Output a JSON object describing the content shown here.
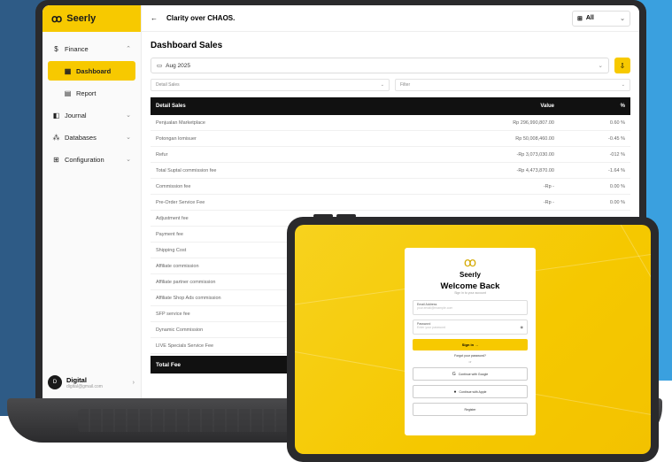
{
  "app": {
    "brand": "Seerly",
    "header_title": "Clarity over CHAOS.",
    "filter_all": "All"
  },
  "sidebar": {
    "items": [
      {
        "label": "Finance",
        "icon": "dollar-icon"
      },
      {
        "label": "Dashboard",
        "icon": "grid-icon"
      },
      {
        "label": "Report",
        "icon": "document-icon"
      },
      {
        "label": "Journal",
        "icon": "book-icon"
      },
      {
        "label": "Databases",
        "icon": "database-icon"
      },
      {
        "label": "Configuration",
        "icon": "settings-icon"
      }
    ],
    "user": {
      "initial": "D",
      "name": "Digital",
      "email": "digital@gmail.com"
    }
  },
  "dashboard": {
    "title": "Dashboard Sales",
    "date_value": "Aug 2025",
    "filter_detail": "Detail Sales",
    "filter_filter": "Filter",
    "table_header": {
      "name": "Detail Sales",
      "value": "Value",
      "pct": "%"
    },
    "rows": [
      {
        "name": "Penjualan Marketplace",
        "value": "Rp 296,990,807.00",
        "pct": "0.60 %"
      },
      {
        "name": "Potongan lomisuer",
        "value": "Rp 50,008,460.00",
        "pct": "-0.45 %"
      },
      {
        "name": "Refur",
        "value": "-Rp 3,073,030.00",
        "pct": "-012 %"
      },
      {
        "name": "Total Suptal commission fee",
        "value": "-Rp 4,473,870.00",
        "pct": "-1.64 %"
      },
      {
        "name": "Commission fee",
        "value": "-Rp -",
        "pct": "0.00 %"
      },
      {
        "name": "Pre-Order Service Fee",
        "value": "-Rp -",
        "pct": "0.00 %"
      },
      {
        "name": "Adjustment fee",
        "value": "",
        "pct": ""
      },
      {
        "name": "Payment fee",
        "value": "",
        "pct": ""
      },
      {
        "name": "Shipping Cost",
        "value": "",
        "pct": ""
      },
      {
        "name": "Affiliate commission",
        "value": "",
        "pct": ""
      },
      {
        "name": "Affiliate partner commission",
        "value": "",
        "pct": ""
      },
      {
        "name": "Affiliate Shop Ads commission",
        "value": "",
        "pct": ""
      },
      {
        "name": "SFP service fee",
        "value": "",
        "pct": ""
      },
      {
        "name": "Dynamic Commission",
        "value": "",
        "pct": ""
      },
      {
        "name": "LIVE Specials Service Fee",
        "value": "",
        "pct": ""
      }
    ],
    "footer_label": "Total Fee"
  },
  "login": {
    "brand": "Seerly",
    "title": "Welcome Back",
    "subtitle": "Sign in to your account",
    "email_label": "Email Address",
    "email_placeholder": "your.email@example.com",
    "password_label": "Password",
    "password_placeholder": "Enter your password",
    "sign_in": "Sign in",
    "forgot": "Forgot your password?",
    "or": "or",
    "google": "Continue with Google",
    "apple": "Continue with Apple",
    "register": "Register"
  },
  "colors": {
    "accent": "#f7c900",
    "dark": "#111111",
    "bg_blue": "#2e5b86",
    "bg_light_blue": "#3aa0df"
  }
}
